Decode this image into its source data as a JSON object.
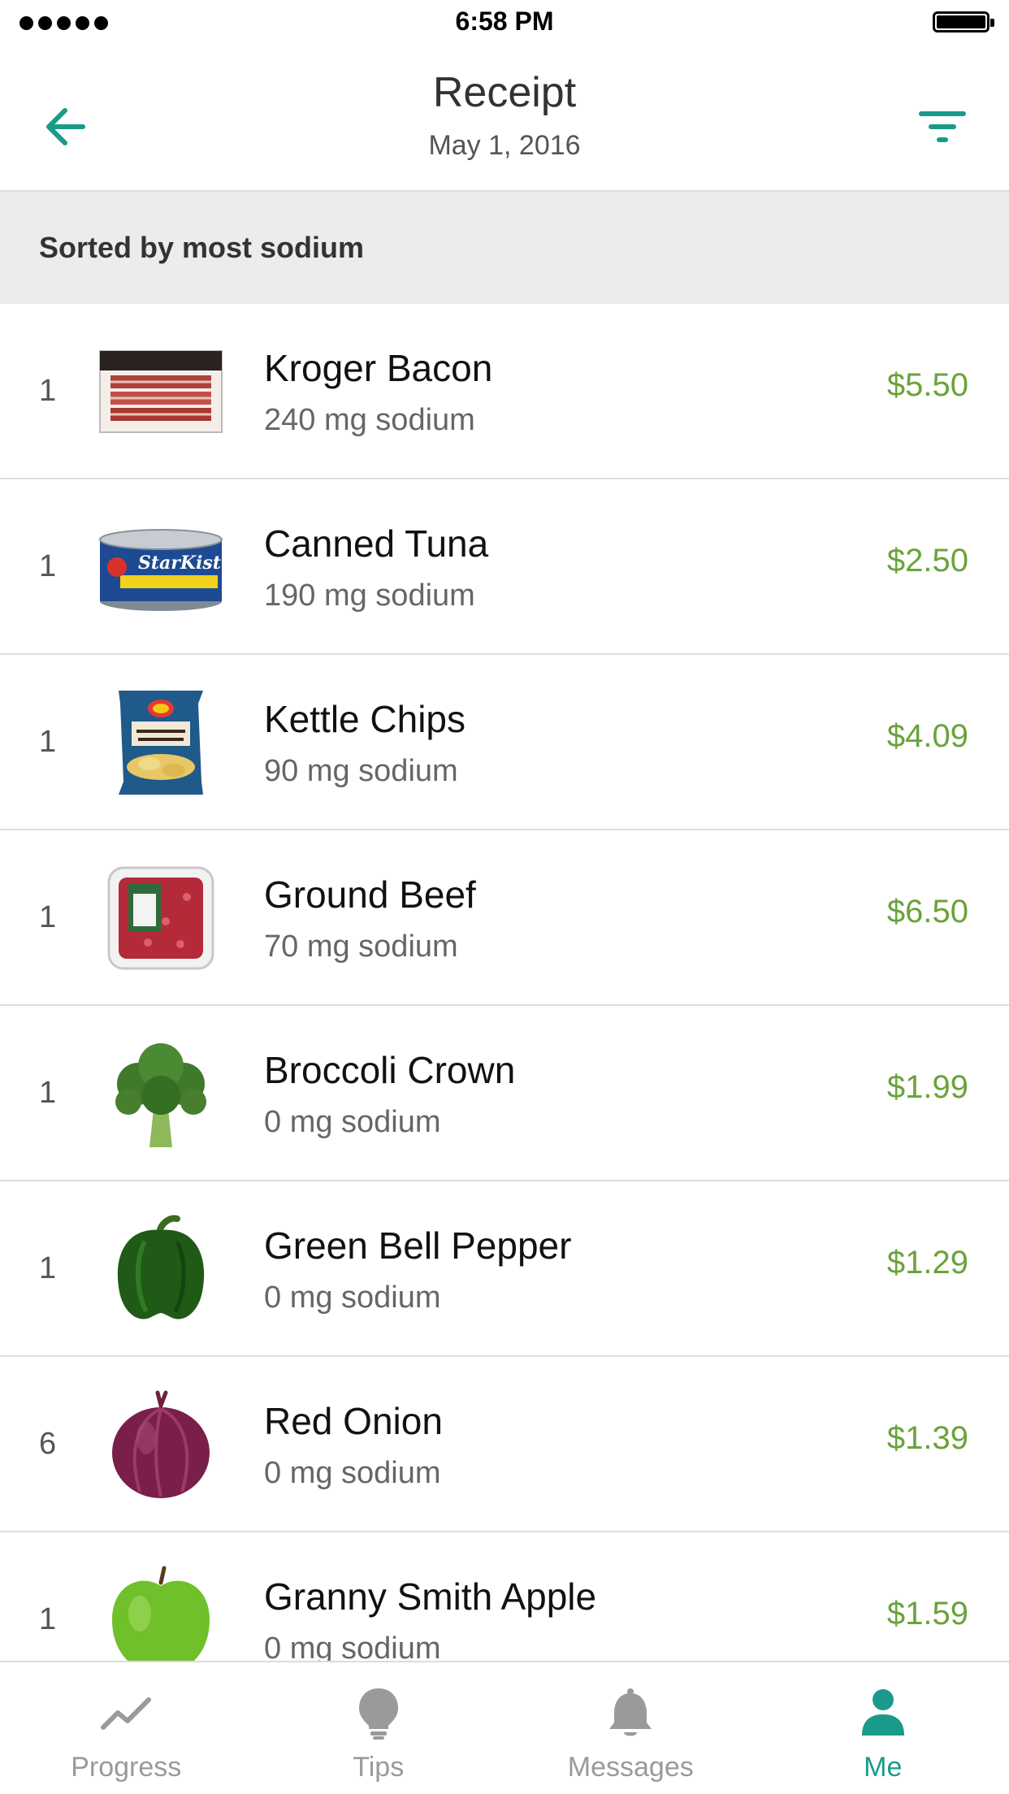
{
  "status_bar": {
    "time": "6:58 PM"
  },
  "header": {
    "title": "Receipt",
    "date": "May 1, 2016"
  },
  "sort": {
    "label": "Sorted by most sodium"
  },
  "items": [
    {
      "qty": "1",
      "name": "Kroger Bacon",
      "sodium": "240 mg sodium",
      "price": "$5.50",
      "image": "bacon-package"
    },
    {
      "qty": "1",
      "name": "Canned Tuna",
      "sodium": "190 mg sodium",
      "price": "$2.50",
      "image": "tuna-can"
    },
    {
      "qty": "1",
      "name": "Kettle Chips",
      "sodium": "90 mg sodium",
      "price": "$4.09",
      "image": "chips-bag"
    },
    {
      "qty": "1",
      "name": "Ground Beef",
      "sodium": "70 mg sodium",
      "price": "$6.50",
      "image": "beef-tray"
    },
    {
      "qty": "1",
      "name": "Broccoli Crown",
      "sodium": "0 mg sodium",
      "price": "$1.99",
      "image": "broccoli"
    },
    {
      "qty": "1",
      "name": "Green Bell Pepper",
      "sodium": "0 mg sodium",
      "price": "$1.29",
      "image": "bell-pepper"
    },
    {
      "qty": "6",
      "name": "Red Onion",
      "sodium": "0 mg sodium",
      "price": "$1.39",
      "image": "red-onion"
    },
    {
      "qty": "1",
      "name": "Granny Smith Apple",
      "sodium": "0 mg sodium",
      "price": "$1.59",
      "image": "green-apple"
    }
  ],
  "tabs": [
    {
      "label": "Progress",
      "icon": "trend-line-icon",
      "active": false
    },
    {
      "label": "Tips",
      "icon": "lightbulb-icon",
      "active": false
    },
    {
      "label": "Messages",
      "icon": "bell-icon",
      "active": false
    },
    {
      "label": "Me",
      "icon": "person-icon",
      "active": true
    }
  ],
  "colors": {
    "accent": "#1a9a8a",
    "price": "#6aa33a",
    "banner": "#ececec",
    "inactive_tab": "#9a9a9a"
  }
}
